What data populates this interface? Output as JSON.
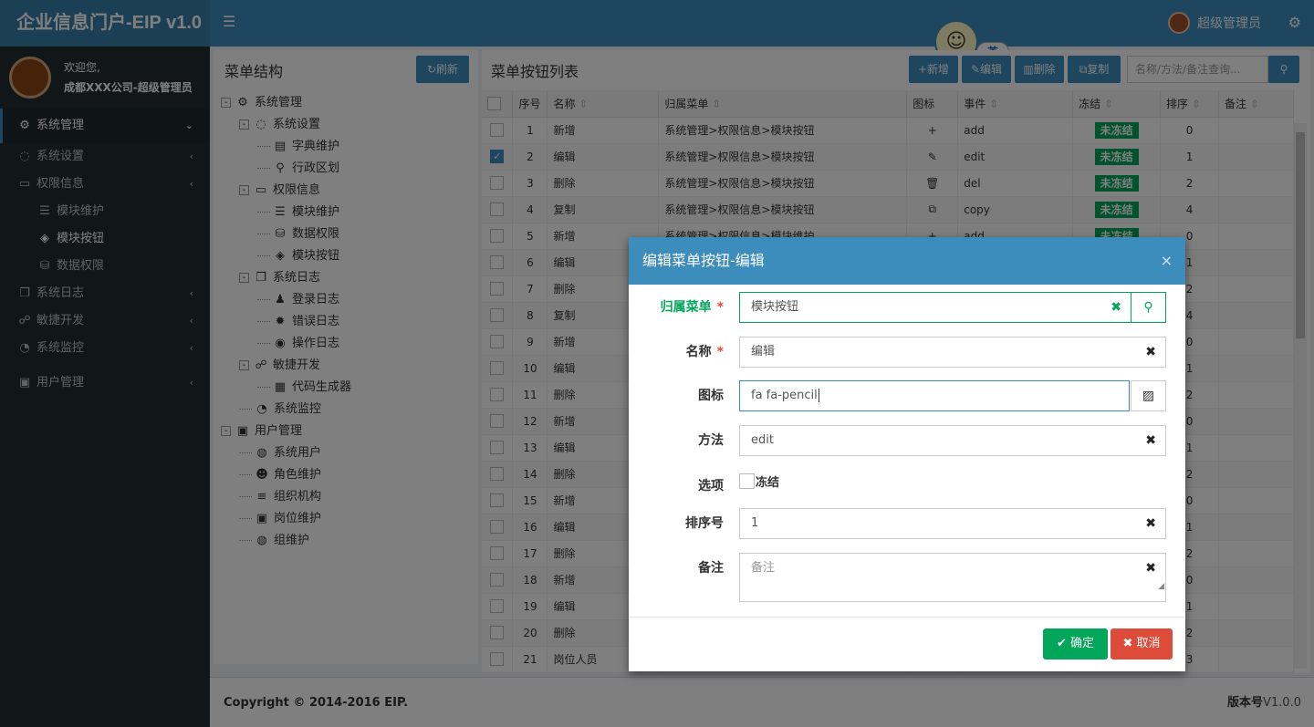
{
  "header": {
    "app_title": "企业信息门户-EIP v1.0",
    "user_name": "超级管理员",
    "ime_label": "英"
  },
  "sidebar": {
    "welcome": "欢迎您,",
    "org_user": "成都XXX公司-超级管理员",
    "items": [
      {
        "label": "系统管理",
        "icon": "gear-icon",
        "active": true
      },
      {
        "label": "系统设置",
        "icon": "circle-gear-icon"
      },
      {
        "label": "权限信息",
        "icon": "monitor-icon"
      },
      {
        "label": "模块维护",
        "icon": "list-icon"
      },
      {
        "label": "模块按钮",
        "icon": "cube-icon"
      },
      {
        "label": "数据权限",
        "icon": "database-icon"
      },
      {
        "label": "系统日志",
        "icon": "copy-icon"
      },
      {
        "label": "敏捷开发",
        "icon": "handshake-icon"
      },
      {
        "label": "系统监控",
        "icon": "dashboard-icon"
      },
      {
        "label": "用户管理",
        "icon": "id-card-icon"
      }
    ]
  },
  "tree": {
    "title": "菜单结构",
    "refresh_label": "刷新",
    "nodes": [
      {
        "label": "系统管理",
        "level": 0,
        "icon": "⚙",
        "toggle": "-"
      },
      {
        "label": "系统设置",
        "level": 1,
        "icon": "◌",
        "toggle": "-"
      },
      {
        "label": "字典维护",
        "level": 2,
        "icon": "▤"
      },
      {
        "label": "行政区划",
        "level": 2,
        "icon": "⚲"
      },
      {
        "label": "权限信息",
        "level": 1,
        "icon": "▭",
        "toggle": "-"
      },
      {
        "label": "模块维护",
        "level": 2,
        "icon": "☰"
      },
      {
        "label": "数据权限",
        "level": 2,
        "icon": "⛁"
      },
      {
        "label": "模块按钮",
        "level": 2,
        "icon": "◈"
      },
      {
        "label": "系统日志",
        "level": 1,
        "icon": "❐",
        "toggle": "-"
      },
      {
        "label": "登录日志",
        "level": 2,
        "icon": "♟"
      },
      {
        "label": "错误日志",
        "level": 2,
        "icon": "✹"
      },
      {
        "label": "操作日志",
        "level": 2,
        "icon": "◉"
      },
      {
        "label": "敏捷开发",
        "level": 1,
        "icon": "☍",
        "toggle": "-"
      },
      {
        "label": "代码生成器",
        "level": 2,
        "icon": "▦"
      },
      {
        "label": "系统监控",
        "level": 1,
        "icon": "◔"
      },
      {
        "label": "用户管理",
        "level": 0,
        "icon": "▣",
        "toggle": "-"
      },
      {
        "label": "系统用户",
        "level": 1,
        "icon": "◍"
      },
      {
        "label": "角色维护",
        "level": 1,
        "icon": "☻"
      },
      {
        "label": "组织机构",
        "level": 1,
        "icon": "≡"
      },
      {
        "label": "岗位维护",
        "level": 1,
        "icon": "▣"
      },
      {
        "label": "组维护",
        "level": 1,
        "icon": "◍"
      }
    ]
  },
  "grid": {
    "title": "菜单按钮列表",
    "toolbar": {
      "add": "新增",
      "edit": "编辑",
      "delete": "删除",
      "copy": "复制"
    },
    "search_placeholder": "名称/方法/备注查询...",
    "columns": [
      "序号",
      "名称",
      "归属菜单",
      "图标",
      "事件",
      "冻结",
      "排序",
      "备注"
    ],
    "rows": [
      {
        "no": "1",
        "name": "新增",
        "menu": "系统管理>权限信息>模块按钮",
        "icon": "+",
        "event": "add",
        "frozen": "未冻结",
        "sort": "0",
        "checked": false
      },
      {
        "no": "2",
        "name": "编辑",
        "menu": "系统管理>权限信息>模块按钮",
        "icon": "✎",
        "event": "edit",
        "frozen": "未冻结",
        "sort": "1",
        "checked": true
      },
      {
        "no": "3",
        "name": "删除",
        "menu": "系统管理>权限信息>模块按钮",
        "icon": "🗑",
        "event": "del",
        "frozen": "未冻结",
        "sort": "2",
        "checked": false
      },
      {
        "no": "4",
        "name": "复制",
        "menu": "系统管理>权限信息>模块按钮",
        "icon": "⧉",
        "event": "copy",
        "frozen": "未冻结",
        "sort": "4",
        "checked": false
      },
      {
        "no": "5",
        "name": "新增",
        "menu": "系统管理>权限信息>模块维护",
        "icon": "+",
        "event": "add",
        "frozen": "未冻结",
        "sort": "0",
        "checked": false
      },
      {
        "no": "6",
        "name": "编辑",
        "menu": "",
        "icon": "",
        "event": "",
        "frozen": "",
        "sort": "1",
        "checked": false
      },
      {
        "no": "7",
        "name": "删除",
        "menu": "",
        "icon": "",
        "event": "",
        "frozen": "",
        "sort": "2",
        "checked": false
      },
      {
        "no": "8",
        "name": "复制",
        "menu": "",
        "icon": "",
        "event": "",
        "frozen": "",
        "sort": "4",
        "checked": false
      },
      {
        "no": "9",
        "name": "新增",
        "menu": "",
        "icon": "",
        "event": "",
        "frozen": "",
        "sort": "0",
        "checked": false
      },
      {
        "no": "10",
        "name": "编辑",
        "menu": "",
        "icon": "",
        "event": "",
        "frozen": "",
        "sort": "1",
        "checked": false
      },
      {
        "no": "11",
        "name": "删除",
        "menu": "",
        "icon": "",
        "event": "",
        "frozen": "",
        "sort": "2",
        "checked": false
      },
      {
        "no": "12",
        "name": "新增",
        "menu": "",
        "icon": "",
        "event": "",
        "frozen": "",
        "sort": "0",
        "checked": false
      },
      {
        "no": "13",
        "name": "编辑",
        "menu": "",
        "icon": "",
        "event": "",
        "frozen": "",
        "sort": "1",
        "checked": false
      },
      {
        "no": "14",
        "name": "删除",
        "menu": "",
        "icon": "",
        "event": "",
        "frozen": "",
        "sort": "2",
        "checked": false
      },
      {
        "no": "15",
        "name": "新增",
        "menu": "",
        "icon": "",
        "event": "",
        "frozen": "",
        "sort": "0",
        "checked": false
      },
      {
        "no": "16",
        "name": "编辑",
        "menu": "",
        "icon": "",
        "event": "",
        "frozen": "",
        "sort": "1",
        "checked": false
      },
      {
        "no": "17",
        "name": "删除",
        "menu": "",
        "icon": "",
        "event": "",
        "frozen": "",
        "sort": "2",
        "checked": false
      },
      {
        "no": "18",
        "name": "新增",
        "menu": "",
        "icon": "",
        "event": "",
        "frozen": "",
        "sort": "0",
        "checked": false
      },
      {
        "no": "19",
        "name": "编辑",
        "menu": "",
        "icon": "",
        "event": "",
        "frozen": "",
        "sort": "1",
        "checked": false
      },
      {
        "no": "20",
        "name": "删除",
        "menu": "",
        "icon": "",
        "event": "",
        "frozen": "",
        "sort": "2",
        "checked": false
      },
      {
        "no": "21",
        "name": "岗位人员",
        "menu": "",
        "icon": "",
        "event": "",
        "frozen": "",
        "sort": "3",
        "checked": false
      }
    ]
  },
  "footer": {
    "copyright": "Copyright © 2014-2016 EIP.",
    "version_label": "版本号",
    "version": "V1.0.0"
  },
  "modal": {
    "title": "编辑菜单按钮-编辑",
    "fields": {
      "menu_label": "归属菜单",
      "menu_value": "模块按钮",
      "name_label": "名称",
      "name_value": "编辑",
      "icon_label": "图标",
      "icon_value": "fa fa-pencil",
      "method_label": "方法",
      "method_value": "edit",
      "option_label": "选项",
      "freeze_label": "冻结",
      "sort_label": "排序号",
      "sort_value": "1",
      "remark_label": "备注",
      "remark_placeholder": "备注"
    },
    "ok_label": "确定",
    "cancel_label": "取消"
  }
}
